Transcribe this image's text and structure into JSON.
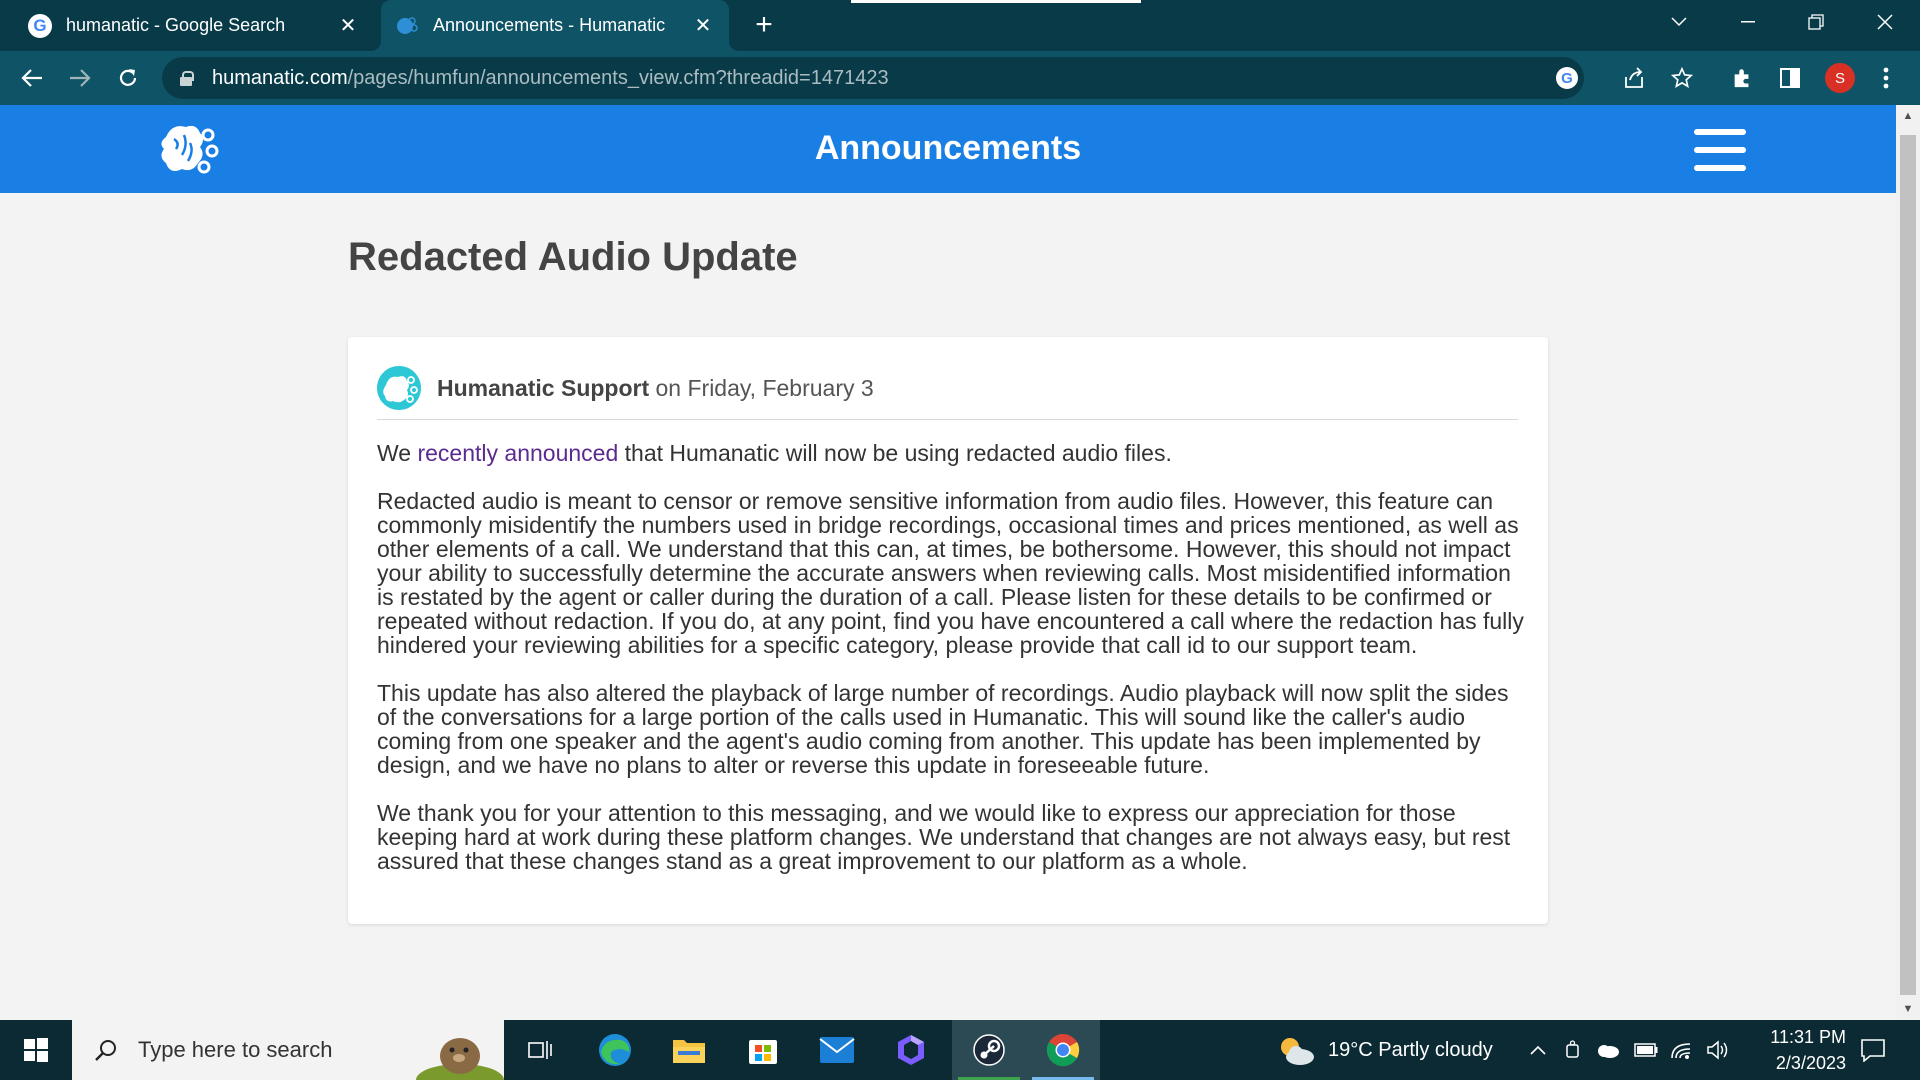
{
  "browser": {
    "tabs": [
      {
        "title": "humanatic - Google Search",
        "active": false,
        "favicon": "google-icon"
      },
      {
        "title": "Announcements - Humanatic",
        "active": true,
        "favicon": "humanatic-icon"
      }
    ],
    "url_host": "humanatic.com",
    "url_path": "/pages/humfun/announcements_view.cfm?threadid=1471423",
    "profile_initial": "S"
  },
  "site": {
    "title": "Announcements"
  },
  "post": {
    "heading": "Redacted Audio Update",
    "author": "Humanatic Support",
    "date_text": " on Friday, February 3",
    "intro_before_link": "We ",
    "intro_link": "recently announced",
    "intro_after_link": " that Humanatic will now be using redacted audio files.",
    "paragraphs": [
      "Redacted audio is meant to censor or remove sensitive information from audio files. However, this feature can commonly misidentify the numbers used in bridge recordings, occasional times and prices mentioned, as well as other elements of a call. We understand that this can, at times, be bothersome. However, this should not impact your ability to successfully determine the accurate answers when reviewing calls. Most misidentified information is restated by the agent or caller during the duration of a call. Please listen for these details to be confirmed or repeated without redaction. If you do, at any point, find you have encountered a call where the redaction has fully hindered your reviewing abilities for a specific category, please provide that call id to our support team.",
      "This update has also altered the playback of large number of recordings. Audio playback will now split the sides of the conversations for a large portion of the calls used in Humanatic. This will sound like the caller's audio coming from one speaker and the agent's audio coming from another. This update has been implemented by design, and we have no plans to alter or reverse this update in foreseeable future.",
      "We thank you for your attention to this messaging, and we would like to express our appreciation for those keeping hard at work during these platform changes. We understand that changes are not always easy, but rest assured that these changes stand as a great improvement to our platform as a whole."
    ]
  },
  "taskbar": {
    "search_placeholder": "Type here to search",
    "weather": "19°C  Partly cloudy",
    "time": "11:31 PM",
    "date": "2/3/2023"
  },
  "colors": {
    "header_blue": "#1a7fe5",
    "chrome_dark": "#083a48",
    "chrome_toolbar": "#0f5466",
    "link_purple": "#5b2a91"
  }
}
